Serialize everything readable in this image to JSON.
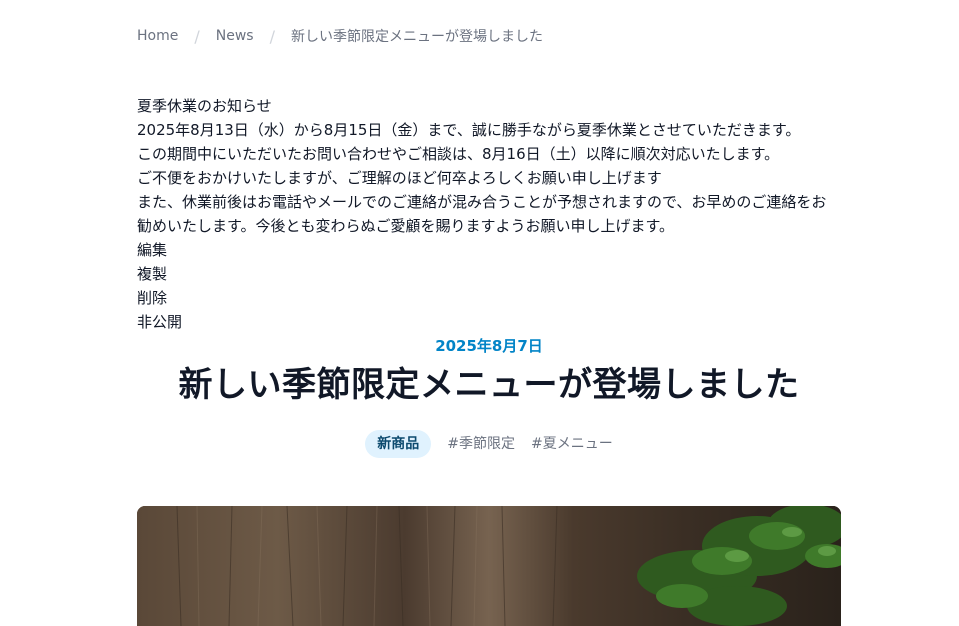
{
  "breadcrumb": {
    "home": "Home",
    "news": "News",
    "current": "新しい季節限定メニューが登場しました"
  },
  "notice": {
    "title": "夏季休業のお知らせ",
    "line1": "2025年8月13日（水）から8月15日（金）まで、誠に勝手ながら夏季休業とさせていただきます。",
    "line2": "この期間中にいただいたお問い合わせやご相談は、8月16日（土）以降に順次対応いたします。",
    "line3": "ご不便をおかけいたしますが、ご理解のほど何卒よろしくお願い申し上げます",
    "line4": "また、休業前後はお電話やメールでのご連絡が混み合うことが予想されますので、お早めのご連絡をお勧めいたします。今後とも変わらぬご愛顧を賜りますようお願い申し上げます。",
    "admin": {
      "edit": "編集",
      "duplicate": "複製",
      "delete": "削除",
      "unpublish": "非公開"
    }
  },
  "article": {
    "date": "2025年8月7日",
    "title": "新しい季節限定メニューが登場しました",
    "category": "新商品",
    "tags": [
      "#季節限定",
      "#夏メニュー"
    ]
  },
  "colors": {
    "accent": "#0284c7",
    "category_bg": "#e0f2fe",
    "muted": "#6b7280"
  }
}
